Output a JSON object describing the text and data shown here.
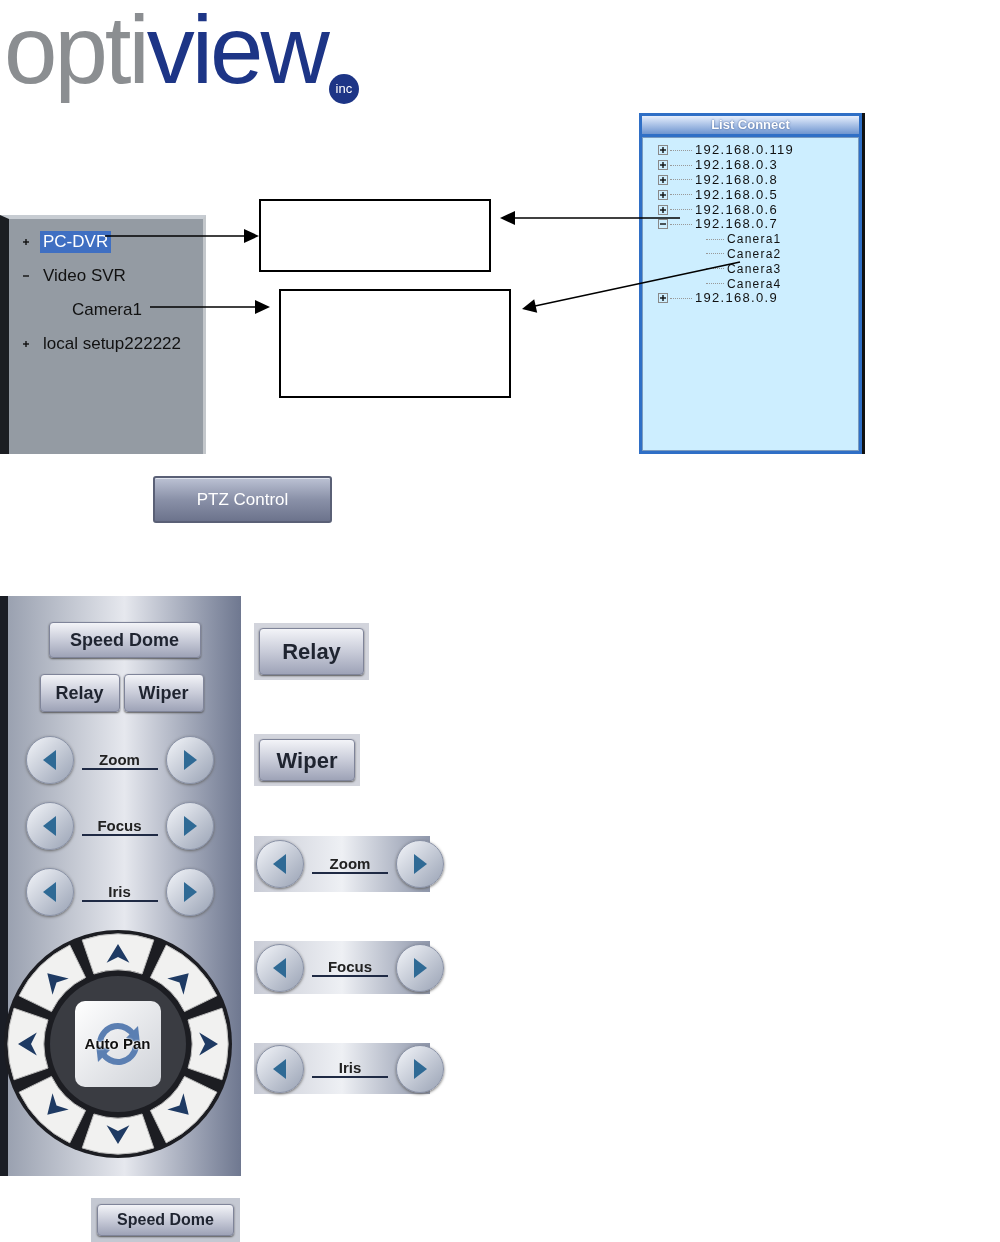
{
  "logo": {
    "text_1": "opti",
    "text_2": "view",
    "badge": "inc"
  },
  "device_tree": [
    {
      "label": "PC-DVR",
      "expanded": false,
      "selected": true
    },
    {
      "label": "Video SVR",
      "expanded": true,
      "selected": false,
      "children": [
        {
          "label": "Camera1",
          "selected": false
        }
      ]
    },
    {
      "label": "local setup222222",
      "expanded": false,
      "selected": false
    }
  ],
  "list_connect": {
    "title": "List Connect",
    "items": [
      {
        "label": "192.168.0.119",
        "expanded": false
      },
      {
        "label": "192.168.0.3",
        "expanded": false
      },
      {
        "label": "192.168.0.8",
        "expanded": false
      },
      {
        "label": "192.168.0.5",
        "expanded": false
      },
      {
        "label": "192.168.0.6",
        "expanded": false
      },
      {
        "label": "192.168.0.7",
        "expanded": true,
        "children": [
          {
            "label": "Canera1"
          },
          {
            "label": "Canera2"
          },
          {
            "label": "Canera3"
          },
          {
            "label": "Canera4"
          }
        ]
      },
      {
        "label": "192.168.0.9",
        "expanded": false
      }
    ]
  },
  "ptz_button": "PTZ Control",
  "ptz_panel": {
    "speed_dome": "Speed Dome",
    "buttons": [
      "Relay",
      "Wiper"
    ],
    "adjusters": [
      "Zoom",
      "Focus",
      "Iris"
    ],
    "auto_pan": "Auto Pan"
  },
  "examples": {
    "buttons": [
      "Relay",
      "Wiper"
    ],
    "adjusters": [
      "Zoom",
      "Focus",
      "Iris"
    ]
  },
  "speed_dome_button": "Speed Dome"
}
